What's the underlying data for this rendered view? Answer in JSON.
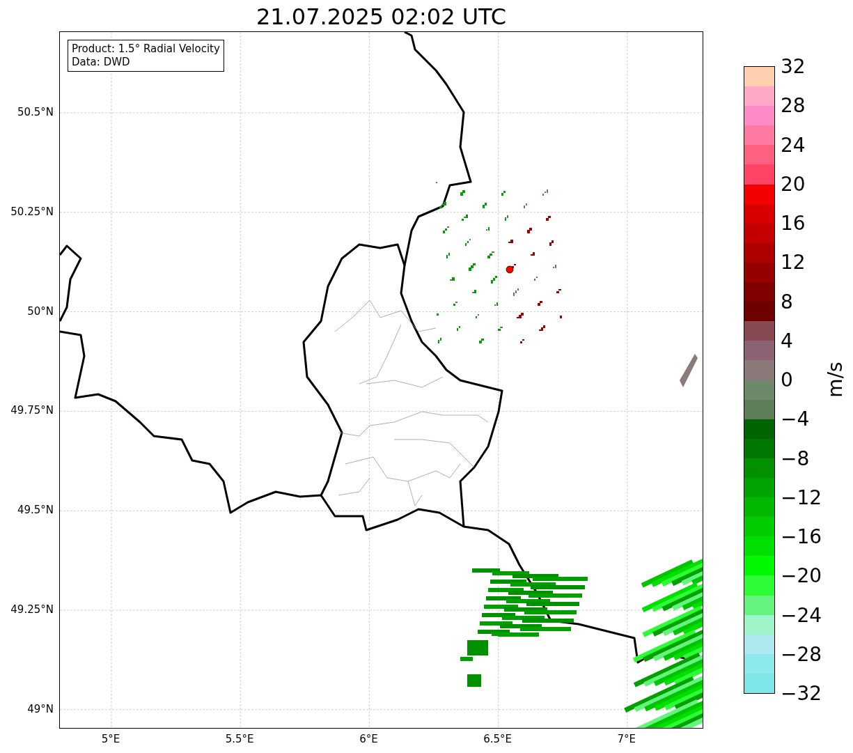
{
  "title": "21.07.2025 02:02 UTC",
  "legend": [
    "Product: 1.5° Radial Velocity",
    "Data: DWD"
  ],
  "lat_ticks": [
    "50.5°N",
    "50.25°N",
    "50°N",
    "49.75°N",
    "49.5°N",
    "49.25°N",
    "49°N"
  ],
  "lon_ticks": [
    "5°E",
    "5.5°E",
    "6°E",
    "6.5°E",
    "7°E"
  ],
  "colorbar": {
    "label": "m/s",
    "ticks": [
      "32",
      "28",
      "24",
      "20",
      "16",
      "12",
      "8",
      "4",
      "0",
      "−4",
      "−8",
      "−12",
      "−16",
      "−20",
      "−24",
      "−28",
      "−32"
    ],
    "bands": [
      {
        "color": "#7de6e8"
      },
      {
        "color": "#8ee9ec"
      },
      {
        "color": "#ade8ee"
      },
      {
        "color": "#9ff5c9"
      },
      {
        "color": "#64f47e"
      },
      {
        "color": "#2cfb36"
      },
      {
        "color": "#00f800"
      },
      {
        "color": "#00e000"
      },
      {
        "color": "#00cc00"
      },
      {
        "color": "#00b800"
      },
      {
        "color": "#00a400"
      },
      {
        "color": "#009000"
      },
      {
        "color": "#007800"
      },
      {
        "color": "#006400"
      },
      {
        "color": "#5e7e5a"
      },
      {
        "color": "#6e896a"
      },
      {
        "color": "#8a7a7a"
      },
      {
        "color": "#8a6272"
      },
      {
        "color": "#884a52"
      },
      {
        "color": "#6e0000"
      },
      {
        "color": "#800000"
      },
      {
        "color": "#960000"
      },
      {
        "color": "#ae0000"
      },
      {
        "color": "#c40000"
      },
      {
        "color": "#da0000"
      },
      {
        "color": "#f40000"
      },
      {
        "color": "#ff4466"
      },
      {
        "color": "#ff5f80"
      },
      {
        "color": "#ff7aa2"
      },
      {
        "color": "#ff8ac8"
      },
      {
        "color": "#ffa8c8"
      },
      {
        "color": "#ffd0b0"
      }
    ]
  }
}
